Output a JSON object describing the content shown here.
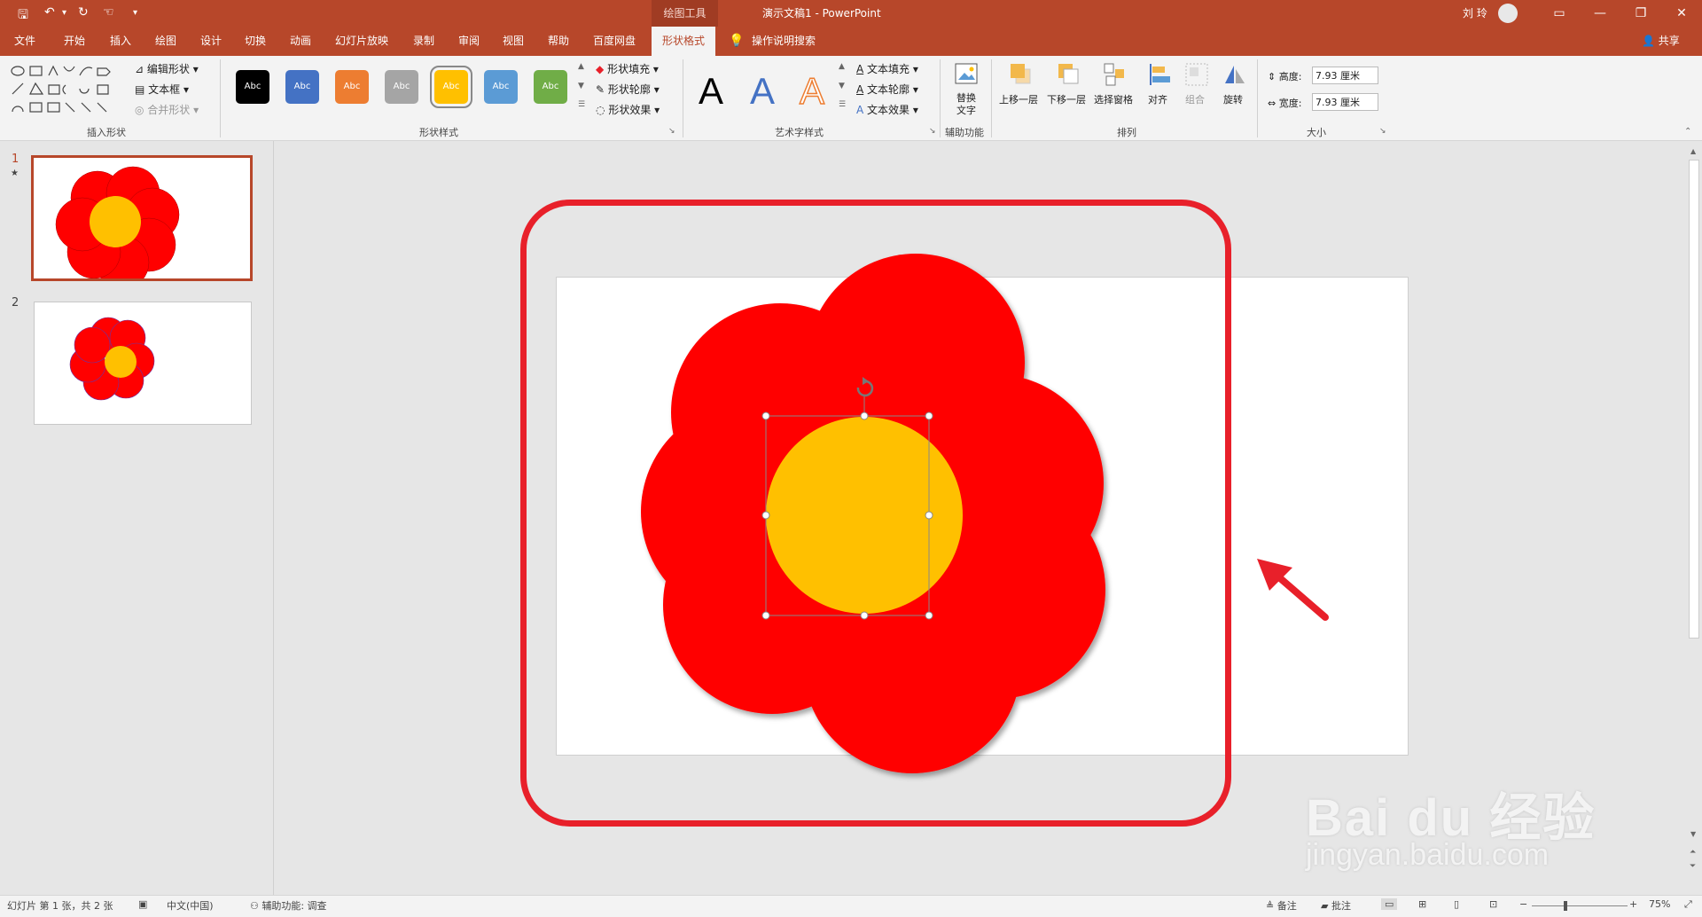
{
  "titlebar": {
    "context_tool": "绘图工具",
    "doc_title": "演示文稿1  -  PowerPoint",
    "user_name": "刘 玲"
  },
  "tabs": [
    "文件",
    "开始",
    "插入",
    "绘图",
    "设计",
    "切换",
    "动画",
    "幻灯片放映",
    "录制",
    "审阅",
    "视图",
    "帮助",
    "百度网盘"
  ],
  "active_tab": "形状格式",
  "tell_me": "操作说明搜索",
  "share": "共享",
  "ribbon": {
    "insert_shapes": {
      "label": "插入形状",
      "edit_shape": "编辑形状",
      "text_box": "文本框",
      "merge_shapes": "合并形状"
    },
    "shape_styles": {
      "label": "形状样式",
      "preset_text": "Abc",
      "fill": "形状填充",
      "outline": "形状轮廓",
      "effects": "形状效果",
      "preset_colors": [
        "#000000",
        "#4472c4",
        "#ed7d31",
        "#a5a5a5",
        "#ffc000",
        "#5b9bd5",
        "#70ad47"
      ]
    },
    "wordart": {
      "label": "艺术字样式",
      "letter": "A",
      "text_fill": "文本填充",
      "text_outline": "文本轮廓",
      "text_effects": "文本效果"
    },
    "accessibility": {
      "label": "辅助功能",
      "alt_text_1": "替换",
      "alt_text_2": "文字"
    },
    "arrange": {
      "label": "排列",
      "bring_forward": "上移一层",
      "send_backward": "下移一层",
      "selection_pane": "选择窗格",
      "align": "对齐",
      "group": "组合",
      "rotate": "旋转"
    },
    "size": {
      "label": "大小",
      "height_label": "高度:",
      "height_value": "7.93 厘米",
      "width_label": "宽度:",
      "width_value": "7.93 厘米"
    }
  },
  "slides": [
    {
      "number": "1",
      "star": "★",
      "selected": true
    },
    {
      "number": "2",
      "star": "",
      "selected": false
    }
  ],
  "colors": {
    "accent": "#b7472a",
    "petal": "#ff0000",
    "center": "#ffc000",
    "frame": "#e8202a"
  },
  "statusbar": {
    "slide_info": "幻灯片 第 1 张，共 2 张",
    "language": "中文(中国)",
    "accessibility": "辅助功能: 调查",
    "notes": "备注",
    "comments": "批注",
    "zoom": "75%"
  },
  "watermark": {
    "brand": "Bai du 经验",
    "url": "jingyan.baidu.com"
  }
}
